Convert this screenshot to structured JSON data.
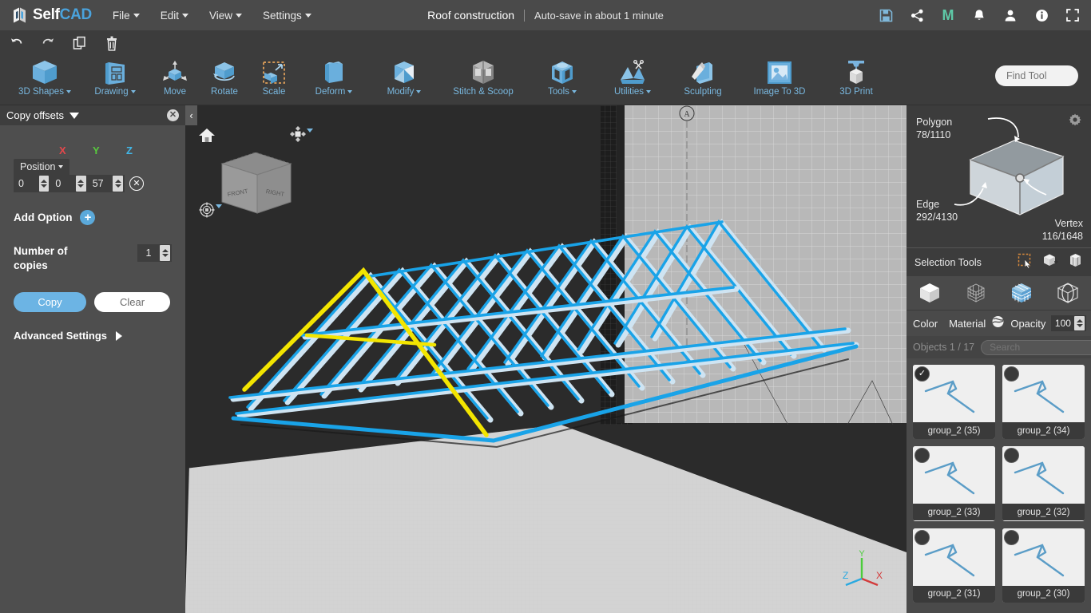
{
  "app": {
    "name_self": "Self",
    "name_cad": "CAD",
    "logo_icon": "selfcad-logo-icon"
  },
  "menubar": {
    "items": [
      {
        "label": "File",
        "has_caret": true
      },
      {
        "label": "Edit",
        "has_caret": true
      },
      {
        "label": "View",
        "has_caret": true
      },
      {
        "label": "Settings",
        "has_caret": true
      }
    ],
    "doc_title": "Roof construction",
    "autosave": "Auto-save in about 1 minute",
    "right_icons": [
      {
        "name": "save-icon",
        "glyph": "save"
      },
      {
        "name": "share-icon",
        "glyph": "share"
      },
      {
        "name": "mega-icon",
        "glyph": "M"
      },
      {
        "name": "notifications-bell-icon",
        "glyph": "bell"
      },
      {
        "name": "user-account-icon",
        "glyph": "user"
      },
      {
        "name": "info-icon",
        "glyph": "info"
      },
      {
        "name": "fullscreen-icon",
        "glyph": "expand"
      }
    ]
  },
  "quickbar": {
    "items": [
      {
        "name": "undo-button",
        "label": "Undo"
      },
      {
        "name": "redo-button",
        "label": "Redo"
      },
      {
        "name": "copy-button",
        "label": "Copy"
      },
      {
        "name": "delete-button",
        "label": "Delete"
      }
    ]
  },
  "toolbar": {
    "tools": [
      {
        "label": "3D Shapes",
        "caret": true,
        "icon": "cube-icon"
      },
      {
        "label": "Drawing",
        "caret": true,
        "icon": "drawing-board-icon"
      },
      {
        "label": "Move",
        "caret": false,
        "icon": "move-arrows-icon"
      },
      {
        "label": "Rotate",
        "caret": false,
        "icon": "rotate-icon"
      },
      {
        "label": "Scale",
        "caret": false,
        "icon": "scale-icon"
      },
      {
        "label": "Deform",
        "caret": true,
        "icon": "deform-icon"
      },
      {
        "label": "Modify",
        "caret": true,
        "icon": "modify-icon"
      },
      {
        "label": "Stitch & Scoop",
        "caret": false,
        "icon": "stitch-scoop-icon"
      },
      {
        "label": "Tools",
        "caret": true,
        "icon": "tools-icon"
      },
      {
        "label": "Utilities",
        "caret": true,
        "icon": "utilities-icon"
      },
      {
        "label": "Sculpting",
        "caret": false,
        "icon": "sculpting-icon"
      },
      {
        "label": "Image To 3D",
        "caret": false,
        "icon": "image-to-3d-icon"
      },
      {
        "label": "3D Print",
        "caret": false,
        "icon": "3d-print-icon"
      }
    ],
    "find_tool_placeholder": "Find Tool"
  },
  "left_panel": {
    "title": "Copy offsets",
    "close_label": "✕",
    "axis_labels": {
      "x": "X",
      "y": "Y",
      "z": "Z"
    },
    "position_label": "Position",
    "position": {
      "x": "0",
      "y": "0",
      "z": "57"
    },
    "add_option_label": "Add Option",
    "number_of_copies_label": "Number of copies",
    "number_of_copies": "1",
    "copy_button": "Copy",
    "clear_button": "Clear",
    "advanced_settings": "Advanced Settings"
  },
  "viewport": {
    "collapse_glyph": "‹",
    "viewcube_faces": {
      "front": "FRONT",
      "right": "RIGHT"
    },
    "axis_gizmo": {
      "x": "X",
      "y": "Y",
      "z": "Z"
    },
    "icons": [
      {
        "name": "home-view-icon"
      },
      {
        "name": "orbit-navigation-icon"
      },
      {
        "name": "perspective-view-icon"
      }
    ],
    "colors": {
      "background": "#2b2b2b",
      "selected_highlight": "#f3e500",
      "object_blue": "#19a3e8",
      "blueprint": "#b6b6b6"
    }
  },
  "right_panel": {
    "mesh_stats": {
      "polygon_label": "Polygon",
      "polygon_value": "78/1110",
      "edge_label": "Edge",
      "edge_value": "292/4130",
      "vertex_label": "Vertex",
      "vertex_value": "116/1648"
    },
    "selection_tools_label": "Selection Tools",
    "selection_tool_icons": [
      {
        "name": "rectangle-select-icon"
      },
      {
        "name": "add-select-icon"
      },
      {
        "name": "through-select-icon"
      }
    ],
    "mode_icons": [
      {
        "name": "object-mode-icon"
      },
      {
        "name": "vertex-mode-icon"
      },
      {
        "name": "polygon-mode-icon"
      },
      {
        "name": "edge-mode-icon"
      }
    ],
    "color_label": "Color",
    "color_value": "#121212",
    "material_label": "Material",
    "opacity_label": "Opacity",
    "opacity_value": "100",
    "objects_count_label": "Objects 1 / 17",
    "search_placeholder": "Search",
    "objects": [
      {
        "name": "group_2 (35)",
        "selected": true
      },
      {
        "name": "group_2 (34)",
        "selected": false
      },
      {
        "name": "group_2 (33)",
        "selected": false
      },
      {
        "name": "group_2 (32)",
        "selected": false
      },
      {
        "name": "group_2 (31)",
        "selected": false
      },
      {
        "name": "group_2 (30)",
        "selected": false
      }
    ]
  }
}
